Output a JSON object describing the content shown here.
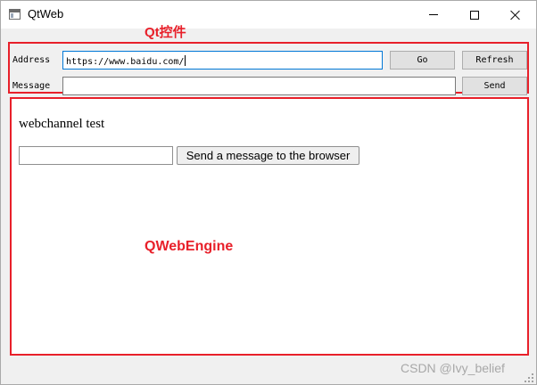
{
  "window": {
    "title": "QtWeb",
    "icon": "app-window-icon"
  },
  "annotations": {
    "qt_controls": "Qt控件",
    "web_engine": "QWebEngine"
  },
  "qt_controls": {
    "address_label": "Address",
    "address_value": "https://www.baidu.com/",
    "message_label": "Message",
    "message_value": "",
    "go_label": "Go",
    "refresh_label": "Refresh",
    "send_label": "Send"
  },
  "web_content": {
    "heading": "webchannel test",
    "input_value": "",
    "send_button_label": "Send a message to the browser"
  },
  "watermark": "CSDN @Ivy_belief",
  "colors": {
    "annotation_red": "#e8202a",
    "focus_border": "#0078d7"
  }
}
